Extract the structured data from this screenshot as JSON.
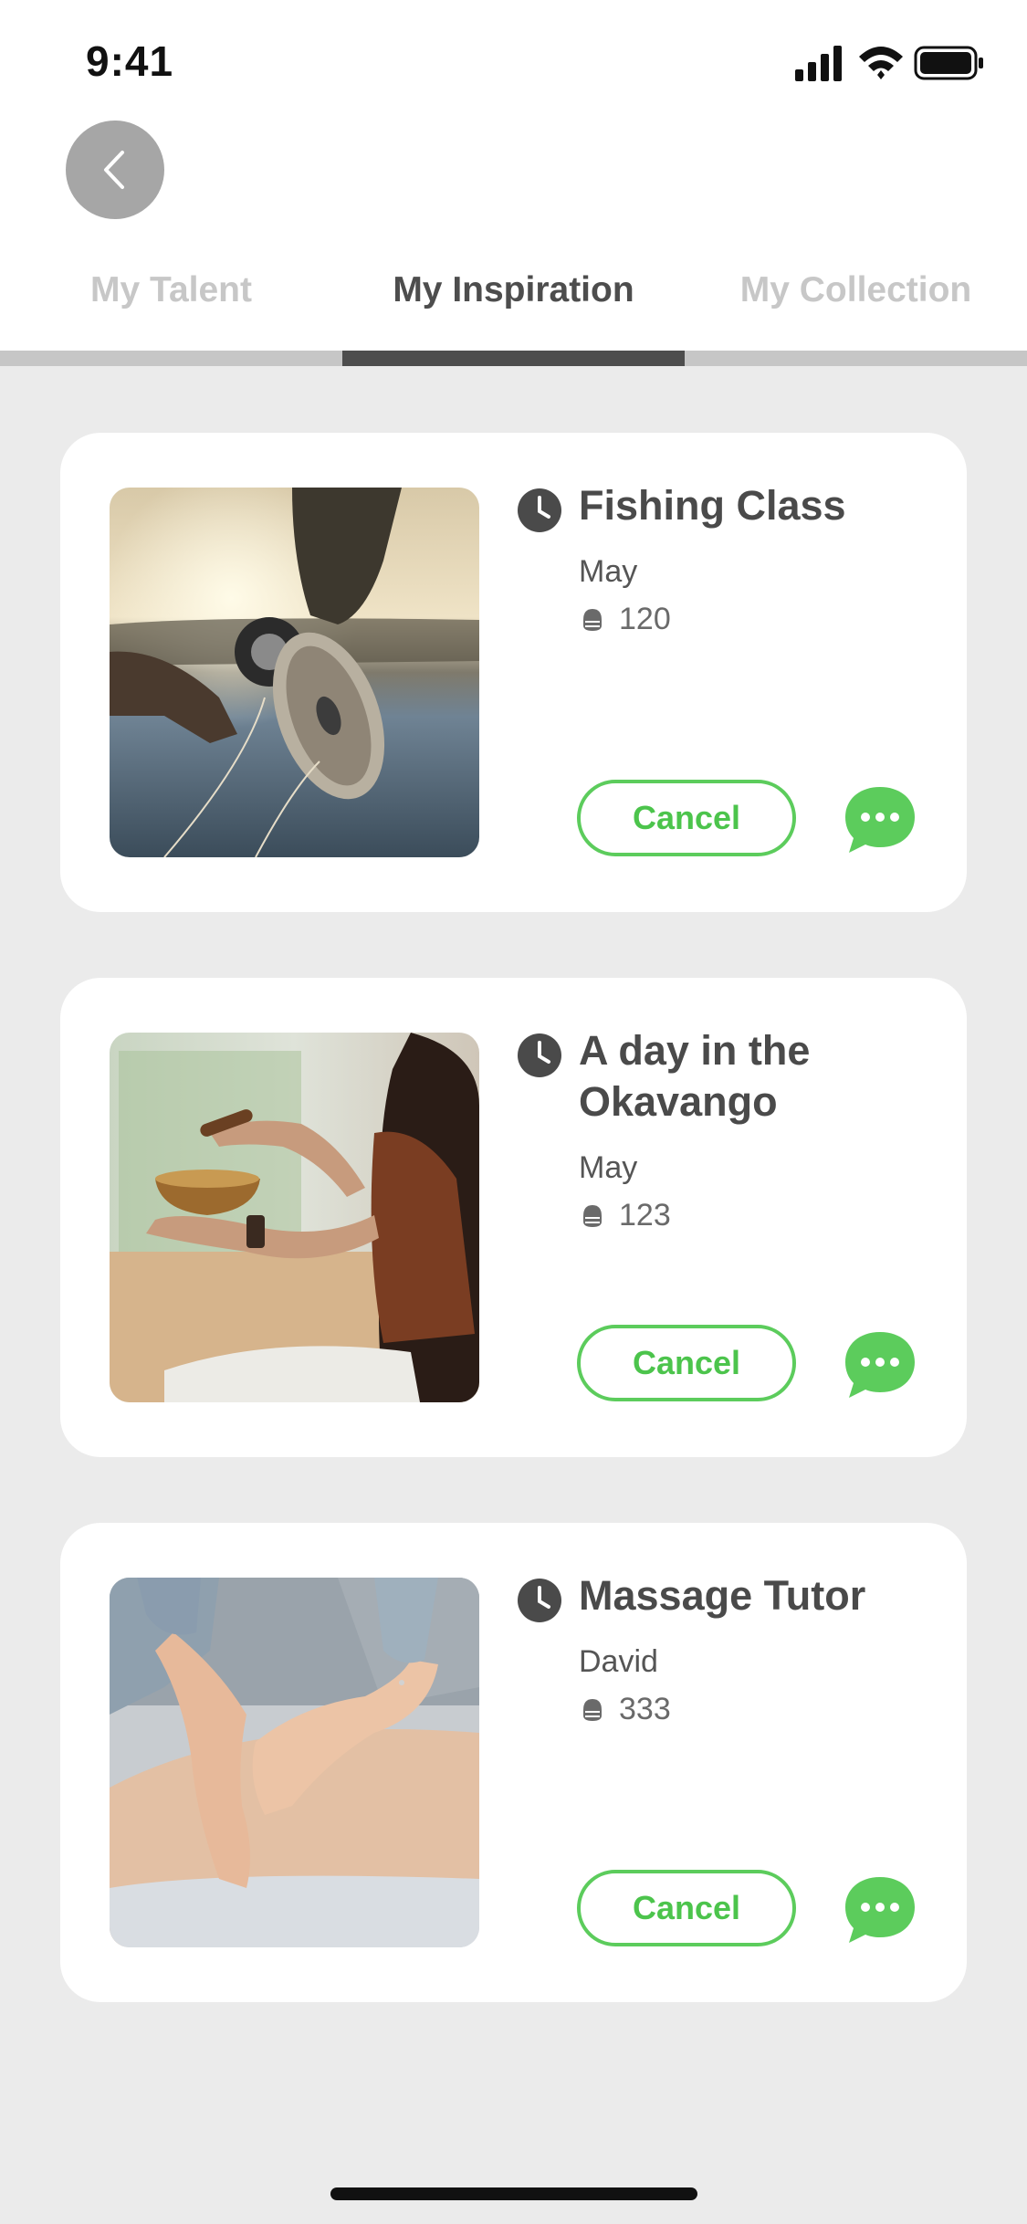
{
  "status_bar": {
    "time": "9:41",
    "icons": [
      "signal-icon",
      "wifi-icon",
      "battery-icon"
    ]
  },
  "header": {
    "back_icon": "chevron-left-icon"
  },
  "tabs": [
    {
      "label": "My Talent",
      "active": false
    },
    {
      "label": "My Inspiration",
      "active": true
    },
    {
      "label": "My Collection",
      "active": false
    }
  ],
  "cards": [
    {
      "title": "Fishing Class",
      "subtitle": "May",
      "price": "120",
      "image": "fly-fishing-reel-photo",
      "cancel_label": "Cancel",
      "chat_icon": "chat-bubble-icon"
    },
    {
      "title": "A day in the Okavango",
      "subtitle": "May",
      "price": "123",
      "image": "singing-bowl-photo",
      "cancel_label": "Cancel",
      "chat_icon": "chat-bubble-icon"
    },
    {
      "title": "Massage Tutor",
      "subtitle": "David",
      "price": "333",
      "image": "massage-photo",
      "cancel_label": "Cancel",
      "chat_icon": "chat-bubble-icon"
    }
  ],
  "colors": {
    "accent": "#5ccc5c",
    "active_tab": "#4d4d4d",
    "inactive_tab": "#c7c7c7",
    "background": "#ebebeb"
  }
}
